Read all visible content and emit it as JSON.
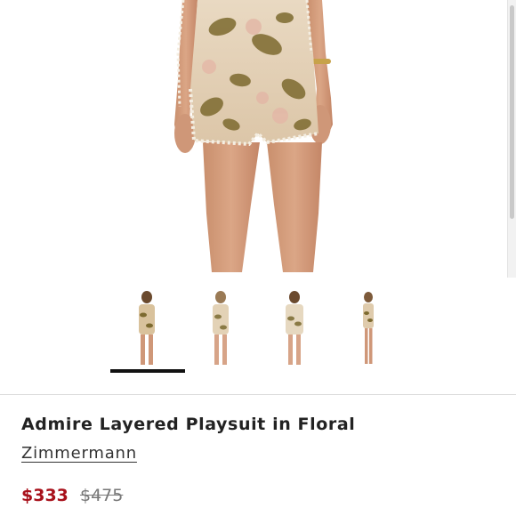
{
  "product": {
    "title": "Admire Layered Playsuit in Floral",
    "brand": "Zimmermann",
    "sale_price": "$333",
    "original_price": "$475"
  },
  "gallery": {
    "main_image": "floral-playsuit-model-photo",
    "thumbnails": [
      {
        "name": "front-view",
        "selected": true
      },
      {
        "name": "front-view-2",
        "selected": false
      },
      {
        "name": "back-view",
        "selected": false
      },
      {
        "name": "full-length-view",
        "selected": false
      }
    ]
  },
  "colors": {
    "sale_price": "#a8111b",
    "text": "#222222",
    "indicator": "#111111"
  }
}
